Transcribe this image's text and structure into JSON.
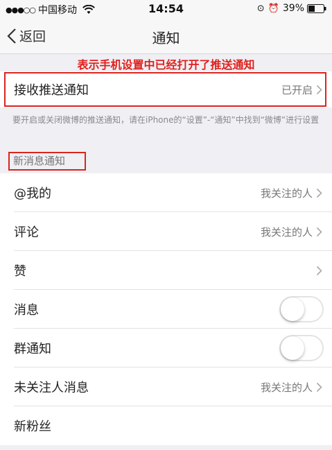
{
  "status_bar": {
    "signal": "●●●○○",
    "carrier": "中国移动",
    "time": "14:54",
    "lock_glyph": "⊙",
    "alarm_glyph": "⏰",
    "battery": "39%"
  },
  "nav": {
    "back_label": "返回",
    "title": "通知"
  },
  "annotation": "表示手机设置中已经打开了推送通知",
  "push_row": {
    "label": "接收推送通知",
    "value": "已开启"
  },
  "hint": "要开启或关闭微博的推送通知，请在iPhone的“设置”-“通知”中找到“微博”进行设置",
  "section_header": "新消息通知",
  "rows": [
    {
      "label": "@我的",
      "value": "我关注的人"
    },
    {
      "label": "评论",
      "value": "我关注的人"
    },
    {
      "label": "赞",
      "value": ""
    },
    {
      "label": "消息",
      "toggle_on": false
    },
    {
      "label": "群通知",
      "toggle_on": false
    },
    {
      "label": "未关注人消息",
      "value": "我关注的人"
    },
    {
      "label": "新粉丝"
    }
  ],
  "colors": {
    "annotation_red": "#e0201b",
    "highlight_border": "#d9241e",
    "background": "#efeff4"
  }
}
